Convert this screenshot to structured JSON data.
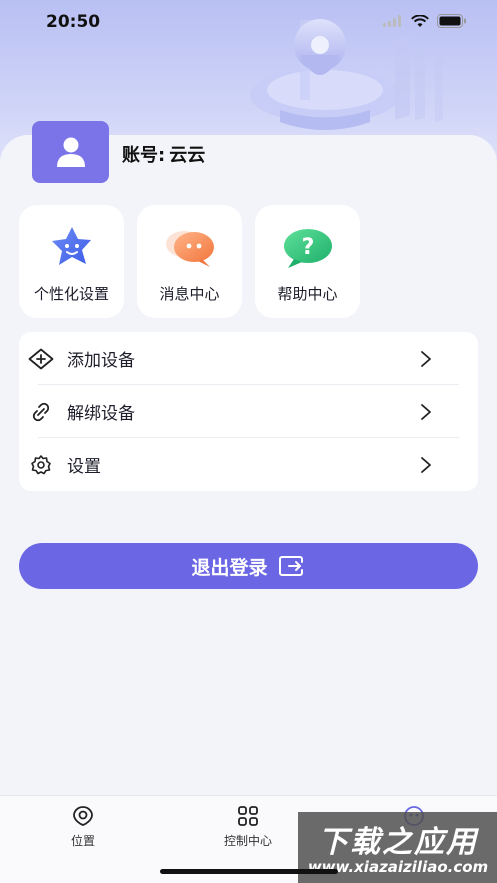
{
  "status_bar": {
    "time": "20:50"
  },
  "profile": {
    "account_label": "账号:",
    "account_name": "云云"
  },
  "quick_tiles": [
    {
      "label": "个性化设置",
      "icon": "star-mascot-icon"
    },
    {
      "label": "消息中心",
      "icon": "chat-bubble-icon"
    },
    {
      "label": "帮助中心",
      "icon": "help-bubble-icon"
    }
  ],
  "menu": [
    {
      "label": "添加设备",
      "icon": "add-device-icon"
    },
    {
      "label": "解绑设备",
      "icon": "unlink-icon"
    },
    {
      "label": "设置",
      "icon": "settings-icon"
    }
  ],
  "logout_label": "退出登录",
  "tabs": [
    {
      "label": "位置",
      "icon": "location-eye-icon"
    },
    {
      "label": "控制中心",
      "icon": "grid-icon"
    },
    {
      "label": "",
      "icon": "mine-face-icon"
    }
  ],
  "watermark": {
    "title": "下载之应用",
    "url": "www.xiazaiziliao.com"
  },
  "colors": {
    "accent": "#6b67e4",
    "avatar": "#7a74e8",
    "hero": "#b9c0f3"
  }
}
